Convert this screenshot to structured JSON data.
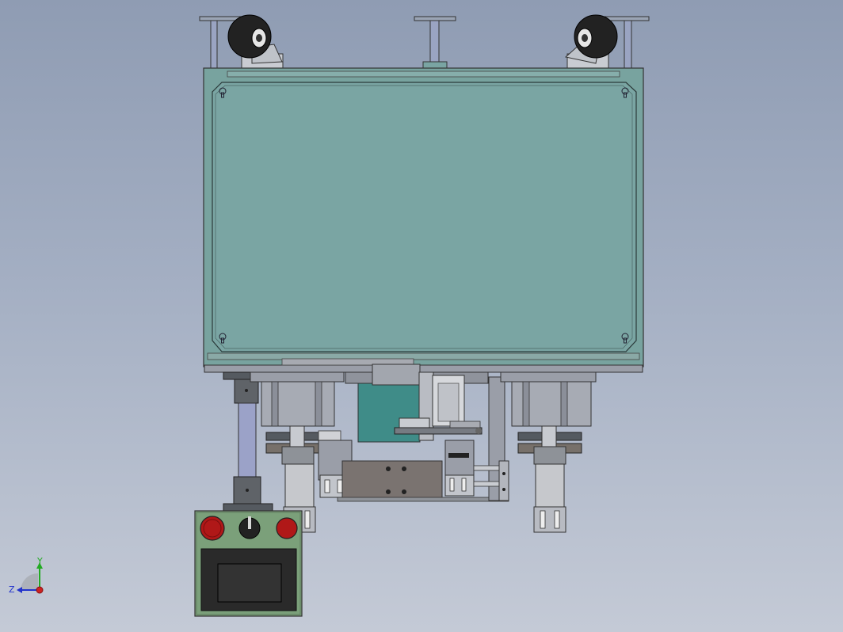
{
  "viewport": {
    "background_top": "#8f9cb3",
    "background_bottom": "#c4cad6"
  },
  "colors": {
    "panel_teal": "#7aa5a3",
    "frame_teal": "#78a39f",
    "steel_gray": "#9a9ea8",
    "dark_gray": "#555a60",
    "brown_gray": "#77706a",
    "cylinder_blue": "#9ba2c8",
    "wheel_black": "#222222",
    "stop_red": "#b01818",
    "screen_black": "#222222",
    "control_box_green": "#7ba07a"
  },
  "triad": {
    "y_label": "Y",
    "z_label": "Z",
    "y_color": "#22aa22",
    "z_color": "#2233cc",
    "origin_color": "#cc2222"
  },
  "icons": [
    "caster-wheel-icon",
    "emergency-stop-icon",
    "selector-switch-icon",
    "view-triad-icon"
  ]
}
